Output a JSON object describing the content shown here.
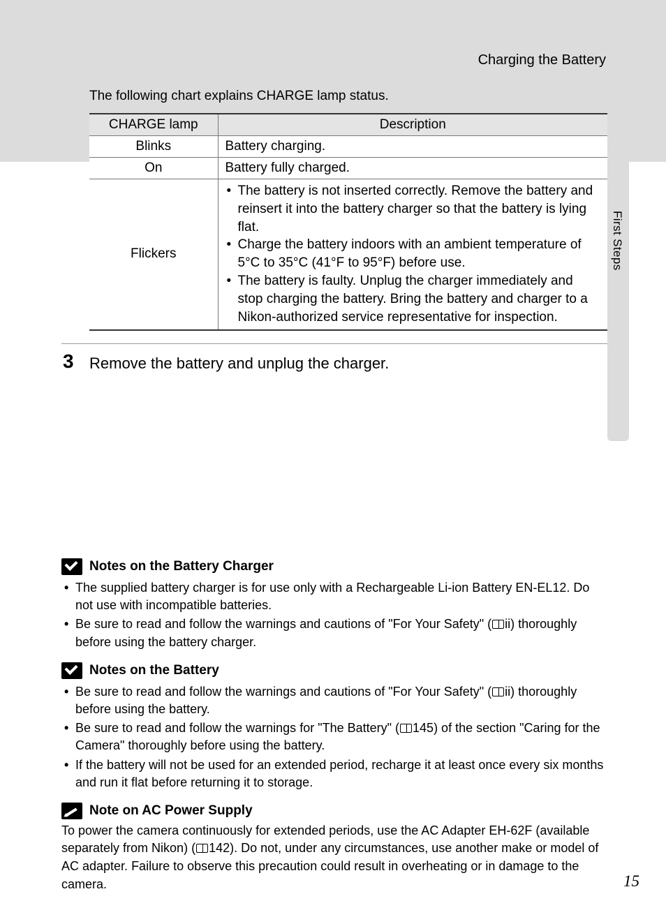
{
  "section_title": "Charging the Battery",
  "side_label": "First Steps",
  "intro": "The following chart explains CHARGE lamp status.",
  "table": {
    "head": {
      "lamp": "CHARGE lamp",
      "desc": "Description"
    },
    "rows": [
      {
        "lamp": "Blinks",
        "desc": "Battery charging."
      },
      {
        "lamp": "On",
        "desc": "Battery fully charged."
      },
      {
        "lamp": "Flickers",
        "bullets": [
          "The battery is not inserted correctly. Remove the battery and reinsert it into the battery charger so that the battery is lying flat.",
          "Charge the battery indoors with an ambient temperature of 5°C to 35°C (41°F to 95°F) before use.",
          "The battery is faulty. Unplug the charger immediately and stop charging the battery. Bring the battery and charger to a Nikon-authorized service representative for inspection."
        ]
      }
    ]
  },
  "step": {
    "num": "3",
    "text": "Remove the battery and unplug the charger."
  },
  "notes": [
    {
      "icon": "check",
      "title": "Notes on the Battery Charger",
      "items": [
        {
          "before": "The supplied battery charger is for use only with a Rechargeable Li-ion Battery EN-EL12. Do not use with incompatible batteries."
        },
        {
          "before": "Be sure to read and follow the warnings and cautions of \"For Your Safety\" (",
          "ref": "ii",
          "after": ") thoroughly before using the battery charger."
        }
      ]
    },
    {
      "icon": "check",
      "title": "Notes on the Battery",
      "items": [
        {
          "before": "Be sure to read and follow the warnings and cautions of \"For Your Safety\" (",
          "ref": "ii",
          "after": ") thoroughly before using the battery."
        },
        {
          "before": "Be sure to read and follow the warnings for \"The Battery\" (",
          "ref": "145",
          "after": ") of the section \"Caring for the Camera\" thoroughly before using the battery."
        },
        {
          "before": "If the battery will not be used for an extended period, recharge it at least once every six months and run it flat before returning it to storage."
        }
      ]
    },
    {
      "icon": "pencil",
      "title": "Note on AC Power Supply",
      "para": {
        "before": "To power the camera continuously for extended periods, use the AC Adapter EH-62F (available separately from Nikon) (",
        "ref": "142",
        "after": "). Do not, under any circumstances, use another make or model of AC adapter. Failure to observe this precaution could result in overheating or in damage to the camera."
      }
    }
  ],
  "page_num": "15"
}
